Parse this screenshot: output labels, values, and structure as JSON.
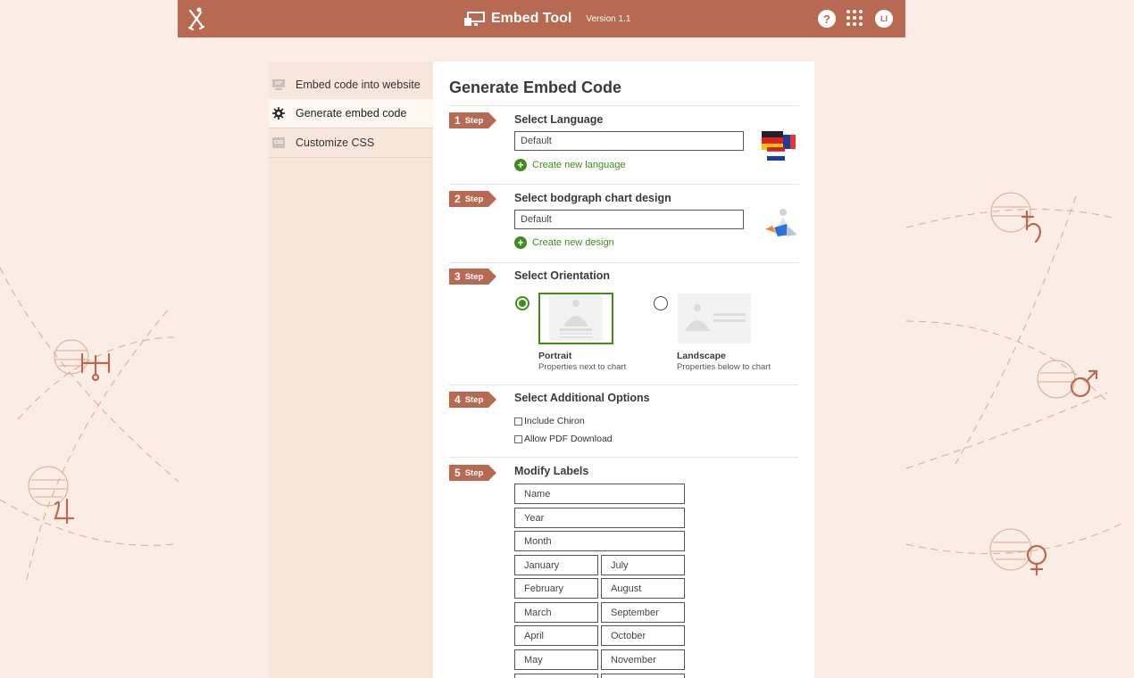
{
  "header": {
    "app_title": "Embed Tool",
    "version": "Version 1.1",
    "avatar_initials": "LI",
    "help_label": "?",
    "brand_color": "#b76951"
  },
  "sidebar": {
    "items": [
      {
        "label": "Embed code into website",
        "icon": "monitor-icon",
        "active": false
      },
      {
        "label": "Generate embed code",
        "icon": "gear-icon",
        "active": true
      },
      {
        "label": "Customize CSS",
        "icon": "css-icon",
        "active": false
      }
    ],
    "css_icon_text": "CSS"
  },
  "main": {
    "title": "Generate Embed Code",
    "step_word": "Step",
    "steps": [
      {
        "number": "1",
        "title": "Select Language",
        "select_value": "Default",
        "link": "Create new language"
      },
      {
        "number": "2",
        "title": "Select bodgraph chart design",
        "select_value": "Default",
        "link": "Create new design"
      },
      {
        "number": "3",
        "title": "Select Orientation",
        "options": [
          {
            "name": "Portrait",
            "desc": "Properties next to chart",
            "selected": true
          },
          {
            "name": "Landscape",
            "desc": "Properties below to chart",
            "selected": false
          }
        ]
      },
      {
        "number": "4",
        "title": "Select Additional Options",
        "checkboxes": [
          {
            "label": "Include Chiron",
            "checked": false
          },
          {
            "label": "Allow PDF Download",
            "checked": false
          }
        ]
      },
      {
        "number": "5",
        "title": "Modify Labels",
        "single_labels": [
          "Name",
          "Year",
          "Month"
        ],
        "month_pairs": [
          [
            "January",
            "July"
          ],
          [
            "February",
            "August"
          ],
          [
            "March",
            "September"
          ],
          [
            "April",
            "October"
          ],
          [
            "May",
            "November"
          ]
        ]
      }
    ],
    "accent_green": "#3e8e1a"
  }
}
